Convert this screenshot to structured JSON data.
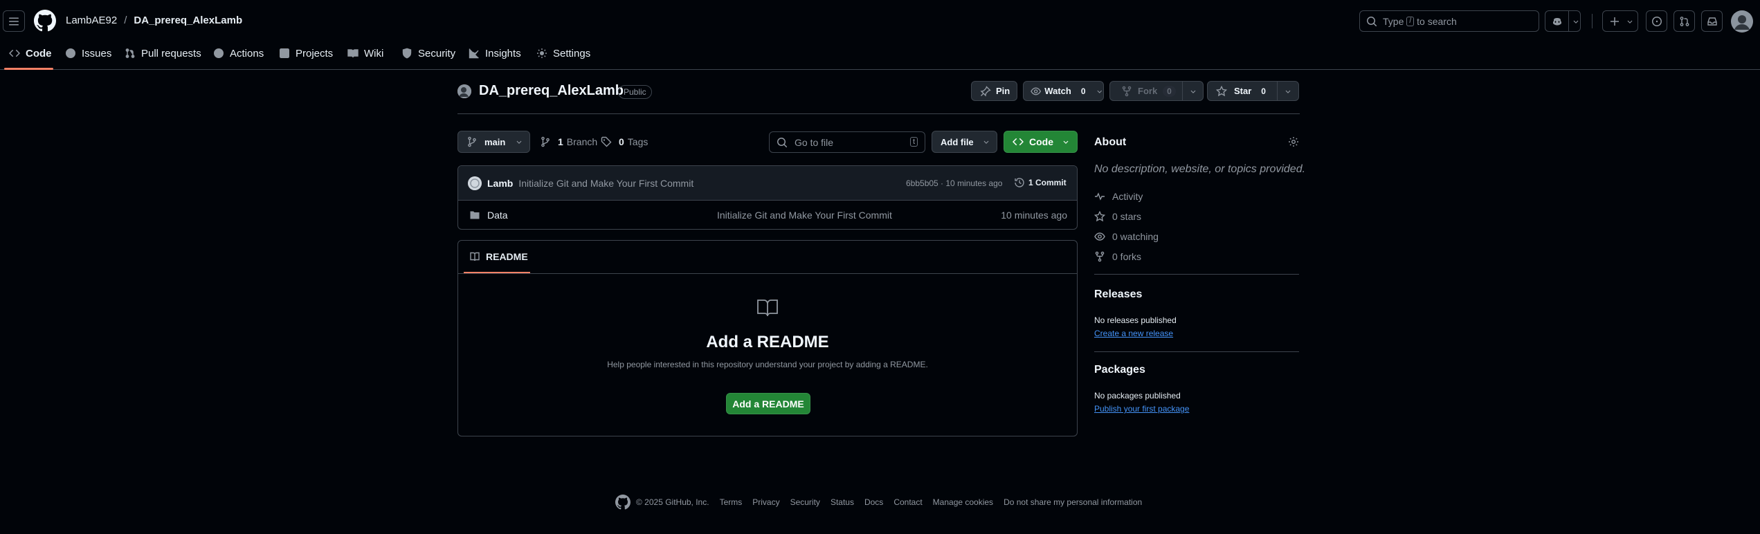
{
  "header": {
    "owner": "LambAE92",
    "separator": "/",
    "repo": "DA_prereq_AlexLamb",
    "search": {
      "prefix": "Type",
      "key": "/",
      "suffix": "to search"
    }
  },
  "tabs": [
    {
      "label": "Code"
    },
    {
      "label": "Issues"
    },
    {
      "label": "Pull requests"
    },
    {
      "label": "Actions"
    },
    {
      "label": "Projects"
    },
    {
      "label": "Wiki"
    },
    {
      "label": "Security"
    },
    {
      "label": "Insights"
    },
    {
      "label": "Settings"
    }
  ],
  "repo": {
    "name": "DA_prereq_AlexLamb",
    "visibility": "Public",
    "pin_label": "Pin",
    "watch_label": "Watch",
    "watch_count": "0",
    "fork_label": "Fork",
    "fork_count": "0",
    "star_label": "Star",
    "star_count": "0"
  },
  "toolbar": {
    "branch": "main",
    "branch_count": "1",
    "branch_word": "Branch",
    "tag_count": "0",
    "tag_word": "Tags",
    "goto_placeholder": "Go to file",
    "goto_key": "t",
    "add_file": "Add file",
    "code": "Code"
  },
  "commit": {
    "author": "Lamb",
    "message": "Initialize Git and Make Your First Commit",
    "hash_time": "6bb5b05 · 10 minutes ago",
    "commit_count": "1 Commit"
  },
  "files": [
    {
      "name": "Data",
      "message": "Initialize Git and Make Your First Commit",
      "time": "10 minutes ago"
    }
  ],
  "readme": {
    "tab_label": "README",
    "title": "Add a README",
    "description": "Help people interested in this repository understand your project by adding a README.",
    "button": "Add a README"
  },
  "about": {
    "title": "About",
    "description": "No description, website, or topics provided.",
    "activity": "Activity",
    "stars": "0 stars",
    "watching": "0 watching",
    "forks": "0 forks"
  },
  "releases": {
    "title": "Releases",
    "empty": "No releases published",
    "link": "Create a new release"
  },
  "packages": {
    "title": "Packages",
    "empty": "No packages published",
    "link": "Publish your first package"
  },
  "footer": {
    "copyright": "© 2025 GitHub, Inc.",
    "links": [
      "Terms",
      "Privacy",
      "Security",
      "Status",
      "Docs",
      "Contact",
      "Manage cookies",
      "Do not share my personal information"
    ]
  },
  "colors": {
    "background": "#010409",
    "accent_underline": "#f78166",
    "primary_button": "#238636",
    "link": "#4493f8"
  },
  "icons": [
    "hamburger-icon",
    "github-logo-icon",
    "search-icon",
    "copilot-icon",
    "plus-icon",
    "issue-icon",
    "pull-request-icon",
    "inbox-icon",
    "code-icon",
    "play-icon",
    "table-icon",
    "book-icon",
    "shield-icon",
    "graph-icon",
    "gear-icon",
    "pin-icon",
    "eye-icon",
    "fork-icon",
    "star-icon",
    "branch-icon",
    "tag-icon",
    "history-icon",
    "folder-icon",
    "pulse-icon"
  ]
}
